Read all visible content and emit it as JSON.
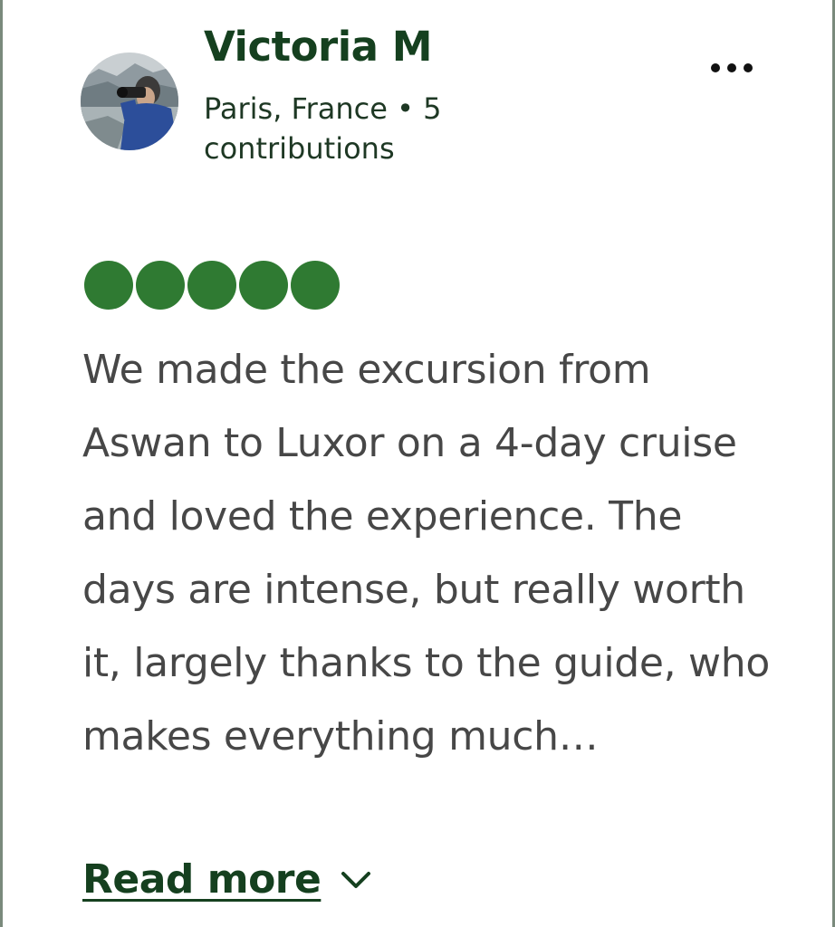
{
  "reviewer": {
    "avatar_icon": "photographer-avatar",
    "name": "Victoria M",
    "location_contributions": "Paris, France • 5 contributions"
  },
  "menu": {
    "icon": "more-horizontal-icon"
  },
  "rating": {
    "value": 5,
    "max": 5,
    "color": "#2f7a32"
  },
  "review": {
    "text": "We made the excursion from Aswan to Luxor on a 4-day cruise and loved the experience. The days are intense, but really worth it, largely thanks to the guide, who makes everything much…",
    "read_more_label": "Read more",
    "read_more_icon": "chevron-down-icon"
  },
  "colors": {
    "name": "#15401f",
    "body_text": "#474747",
    "border": "#7a8a7c"
  }
}
